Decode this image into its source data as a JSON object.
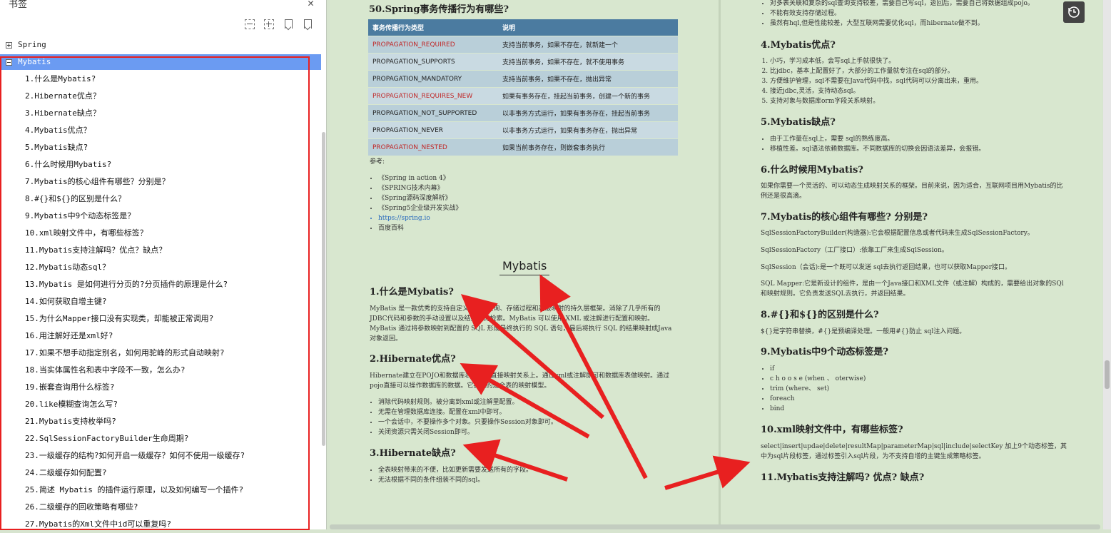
{
  "sidebar": {
    "title": "书签",
    "close_glyph": "✕",
    "toolbar_icons": [
      "collapse-all-icon",
      "expand-all-icon",
      "add-bookmark-icon",
      "bookmark-icon"
    ],
    "spring_label": "Spring",
    "mybatis_label": "Mybatis",
    "items": [
      "1.什么是Mybatis?",
      "2.Hibernate优点？",
      "3.Hibernate缺点？",
      "4.Mybatis优点？",
      "5.Mybatis缺点?",
      "6.什么时候用Mybatis?",
      "7.Mybatis的核心组件有哪些？分别是？",
      "8.#{}和${}的区别是什么？",
      "9.Mybatis中9个动态标签是？",
      "10.xml映射文件中，有哪些标签？",
      "11.Mybatis支持注解吗？优点？缺点？",
      "12.Mybatis动态sql？",
      "13.Mybatis 是如何进行分页的?分页插件的原理是什么?",
      "14.如何获取自增主键?",
      "15.为什么Mapper接口没有实现类，却能被正常调用?",
      "16.用注解好还是xml好?",
      "17.如果不想手动指定别名，如何用驼峰的形式自动映射?",
      "18.当实体属性名和表中字段不一致，怎么办?",
      "19.嵌套查询用什么标签?",
      "20.like模糊查询怎么写?",
      "21.Mybatis支持枚举吗?",
      "22.SqlSessionFactoryBuilder生命周期?",
      "23.一级缓存的结构?如何开启一级缓存？如何不使用一级缓存?",
      "24.二级缓存如何配置?",
      "25.简述 Mybatis 的插件运行原理，以及如何编写一个插件?",
      "26.二级缓存的回收策略有哪些?",
      "27.Mybatis的Xml文件中id可以重复吗?"
    ]
  },
  "left_page": {
    "heading_50": "50.Spring事务传播行为有哪些?",
    "table": {
      "headers": [
        "事务传播行为类型",
        "说明"
      ],
      "rows": [
        {
          "type": "PROPAGATION_REQUIRED",
          "desc": "支持当前事务，如果不存在，就新建一个",
          "red": true
        },
        {
          "type": "PROPAGATION_SUPPORTS",
          "desc": "支持当前事务，如果不存在，就不使用事务",
          "red": false
        },
        {
          "type": "PROPAGATION_MANDATORY",
          "desc": "支持当前事务，如果不存在，抛出异常",
          "red": false
        },
        {
          "type": "PROPAGATION_REQUIRES_NEW",
          "desc": "如果有事务存在，挂起当前事务，创建一个新的事务",
          "red": true
        },
        {
          "type": "PROPAGATION_NOT_SUPPORTED",
          "desc": "以非事务方式运行，如果有事务存在，挂起当前事务",
          "red": false
        },
        {
          "type": "PROPAGATION_NEVER",
          "desc": "以非事务方式运行，如果有事务存在，抛出异常",
          "red": false
        },
        {
          "type": "PROPAGATION_NESTED",
          "desc": "如果当前事务存在，则嵌套事务执行",
          "red": true
        }
      ]
    },
    "ref_label": "参考:",
    "refs": [
      "《Spring in action 4》",
      "《SPRING技术内幕》",
      "《Spring源码深度解析》",
      "《Spring5企业级开发实战》",
      "https://spring.io",
      "百度百科"
    ],
    "chapter": "Mybatis",
    "h1": "1.什么是Mybatis?",
    "p1": "MyBatis 是一款优秀的支持自定义 SQL 查询、存储过程和高级映射的持久层框架。消除了几乎所有的JDBC代码和参数的手动设置以及结果集的检索。MyBatis 可以使用 XML 或注解进行配置和映射。MyBatis 通过将参数映射到配置的 SQL 形成最终执行的 SQL 语句，最后将执行 SQL 的结果映射成Java对象返回。",
    "h2": "2.Hibernate优点?",
    "p2": "Hibernate建立在POJO和数据库表模型的直接映射关系上。通过xml或注解即可和数据库表做映射。通过pojo直接可以操作数据库的数据。它提供的是全表的映射模型。",
    "list2": [
      "消除代码映射规则。被分离到xml或注解里配置。",
      "无需在管理数据库连接。配置在xml中即可。",
      "一个会话中，不要操作多个对象。只要操作Session对象即可。",
      "关闭资源只需关闭Session即可。"
    ],
    "h3": "3.Hibernate缺点?",
    "list3": [
      "全表映射带来的不便，比如更新需要发送所有的字段。",
      "无法根据不同的条件组装不同的sql。"
    ]
  },
  "right_page": {
    "top_list": [
      "对多表关联和复杂的sql查询支持较差，需要自己写sql，返回后，需要自己将数据组成pojo。",
      "不能有效支持存储过程。",
      "虽然有hql,但是性能较差，大型互联网需要优化sql，而hibernate做不到。"
    ],
    "h4": "4.Mybatis优点?",
    "list4": [
      "小巧，学习成本低，会写sql上手就很快了。",
      "比jdbc，基本上配置好了，大部分的工作量就专注在sql的部分。",
      "方便维护管理，sql不需要在Java代码中找，sql代码可以分离出来，重用。",
      "接近jdbc,灵活，支持动态sql。",
      "支持对象与数据库orm字段关系映射。"
    ],
    "h5": "5.Mybatis缺点?",
    "list5": [
      "由于工作量在sql上，需要 sql的熟练度高。",
      "移植性差。sql语法依赖数据库。不同数据库的切换会因语法差异，会报错。"
    ],
    "h6": "6.什么时候用Mybatis?",
    "p6": "如果你需要一个灵活的、可以动态生成映射关系的框架。目前来说，因为适合，互联网项目用Mybatis的比例还是很高滴。",
    "h7": "7.Mybatis的核心组件有哪些? 分别是?",
    "p7a": "SqlSessionFactoryBuilder(构造器):它会根据配置信息或者代码来生成SqlSessionFactory。",
    "p7b": "SqlSessionFactory（工厂接口）:依靠工厂来生成SqlSession。",
    "p7c": "SqlSession（会话):是一个既可以发送 sql去执行返回结果，也可以获取Mapper接口。",
    "p7d": "SQL Mapper:它是新设计的组件，是由一个Java接口和XML文件（或注解）构成的，需要给出对象的SQl和映射规则。它负责发送SQL去执行，并返回结果。",
    "h8": "8.#{}和${}的区别是什么?",
    "p8": "${}是字符串替换，#{}是预编译处理。一般用#{}防止 sql注入问题。",
    "h9": "9.Mybatis中9个动态标签是?",
    "list9": [
      "if",
      "c h o o s e (when 、 oterwise)",
      "trim (where、 set)",
      "foreach",
      "bind"
    ],
    "h10": "10.xml映射文件中，有哪些标签?",
    "p10": "select|insert|updae|delete|resultMap|parameterMap|sql|include|selectKey 加上9个动态标签，其中为sql片段标签，通过标签引入sql片段，为不支持自增的主键生成策略标签。",
    "h11": "11.Mybatis支持注解吗? 优点? 缺点?"
  },
  "colors": {
    "highlight": "#6b9bf2",
    "annotation_red": "#e82020",
    "page_bg": "#d8e7cf",
    "table_header": "#4b7ba0"
  },
  "icons": {
    "history": "history-icon"
  }
}
